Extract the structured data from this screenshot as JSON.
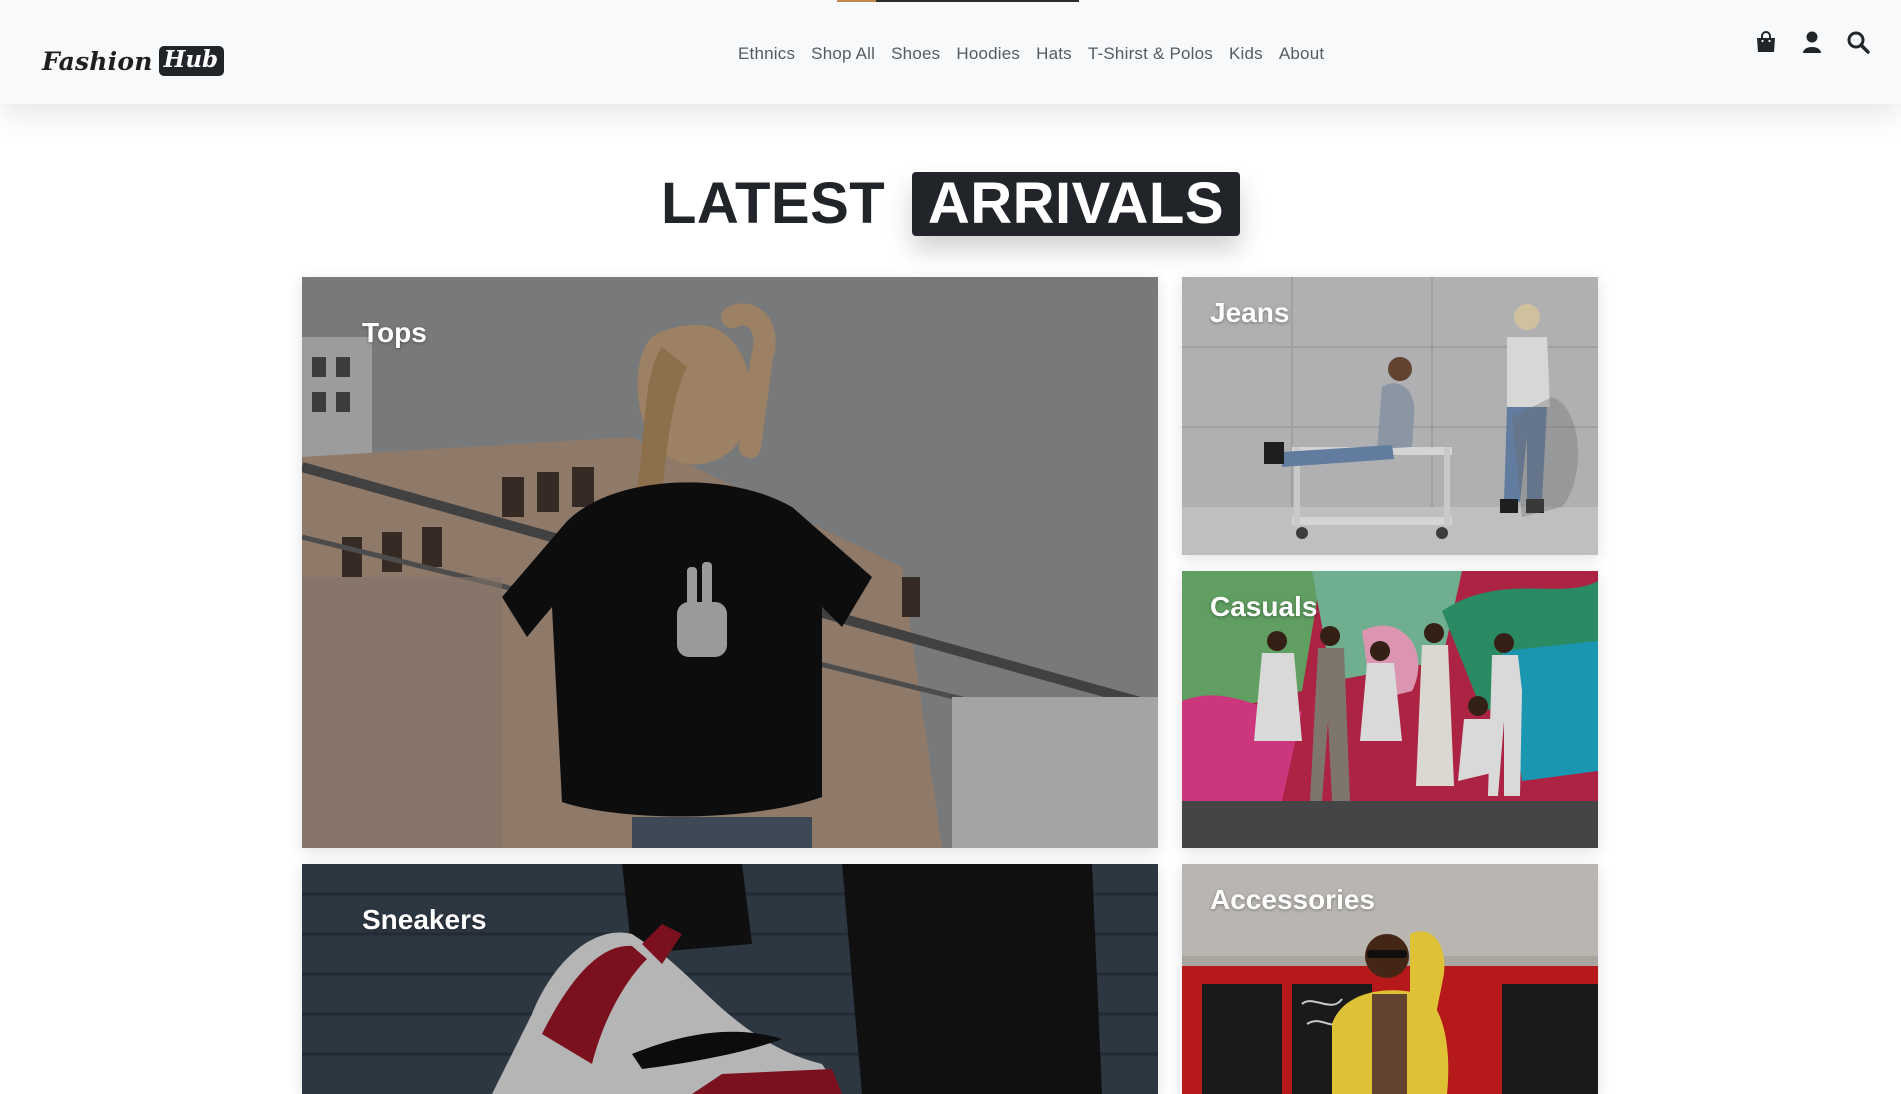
{
  "header": {
    "logo": {
      "word1": "Fashion",
      "word2": "Hub"
    },
    "progress_fraction": 0.16,
    "nav": [
      {
        "label": "Ethnics"
      },
      {
        "label": "Shop All"
      },
      {
        "label": "Shoes"
      },
      {
        "label": "Hoodies"
      },
      {
        "label": "Hats"
      },
      {
        "label": "T-Shirst & Polos"
      },
      {
        "label": "Kids"
      },
      {
        "label": "About"
      }
    ],
    "icons": [
      "shopping-bag-icon",
      "user-icon",
      "search-icon"
    ]
  },
  "section": {
    "title_plain": "LATEST",
    "title_highlight": "ARRIVALS"
  },
  "categories": [
    {
      "label": "Tops"
    },
    {
      "label": "Jeans"
    },
    {
      "label": "Casuals"
    },
    {
      "label": "Sneakers"
    },
    {
      "label": "Accessories"
    }
  ],
  "colors": {
    "header_bg": "#f8f9fa",
    "dark": "#212529",
    "nav_text": "#555b61",
    "progress_accent": "#c08a4a"
  }
}
